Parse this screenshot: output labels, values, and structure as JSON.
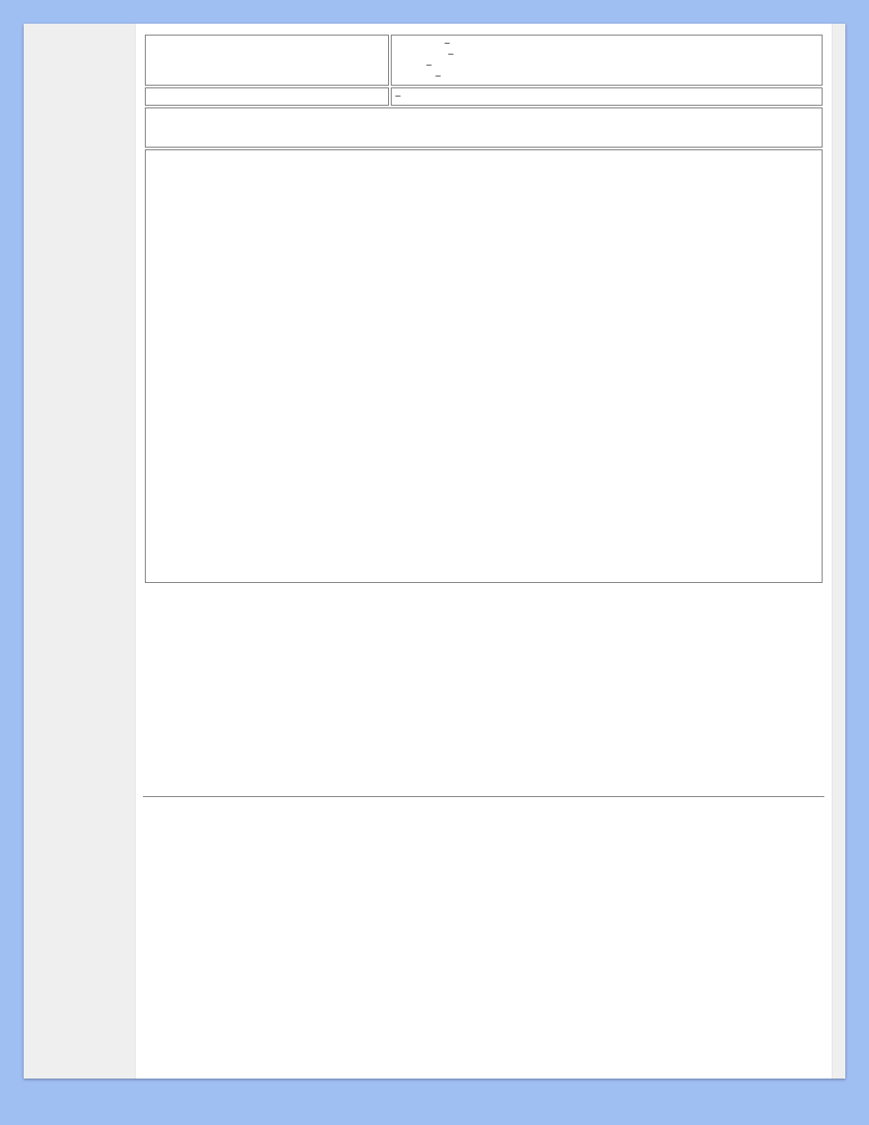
{
  "rows": {
    "r1_left": "",
    "r1_right_lines": [
      "–",
      "–",
      "–",
      "–"
    ],
    "r2_left": "",
    "r2_right": "–"
  },
  "band_text": "",
  "figure_caption": ""
}
